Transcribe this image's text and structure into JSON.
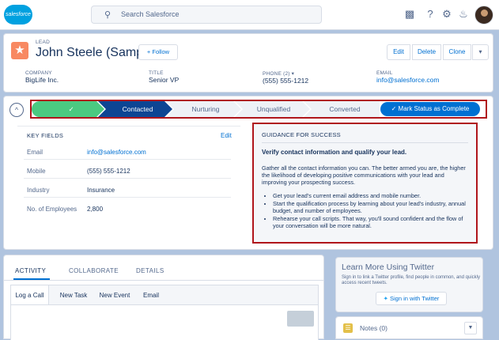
{
  "topbar": {
    "logo_text": "salesforce",
    "search_placeholder": "Search Salesforce",
    "icons": [
      "search-icon",
      "app-launcher-icon",
      "help-icon",
      "setup-gear-icon",
      "notifications-bell-icon"
    ]
  },
  "header": {
    "object_label": "LEAD",
    "record_name": "John Steele (Sample)",
    "follow_label": "+ Follow",
    "actions": {
      "edit": "Edit",
      "delete": "Delete",
      "clone": "Clone",
      "more": "▾"
    },
    "fields": [
      {
        "label": "COMPANY",
        "value": "BigLife Inc."
      },
      {
        "label": "TITLE",
        "value": "Senior VP"
      },
      {
        "label": "PHONE (2) ▾",
        "value": "(555) 555-1212"
      },
      {
        "label": "EMAIL",
        "value": "info@salesforce.com"
      }
    ]
  },
  "path": {
    "completed_icon": "✓",
    "stages": [
      "Contacted",
      "Nurturing",
      "Unqualified",
      "Converted"
    ],
    "current_stage": "Contacted",
    "mark_button": "✓  Mark Status as Complete",
    "colors": {
      "complete": "#4bca81",
      "current": "#0d4593",
      "incomplete": "#eef1f6",
      "highlight": "#b0151b"
    }
  },
  "key_fields": {
    "title": "KEY FIELDS",
    "edit_label": "Edit",
    "rows": [
      {
        "label": "Email",
        "value": "info@salesforce.com"
      },
      {
        "label": "Mobile",
        "value": "(555) 555-1212"
      },
      {
        "label": "Industry",
        "value": "Insurance"
      },
      {
        "label": "No. of Employees",
        "value": "2,800"
      }
    ]
  },
  "guidance": {
    "title": "GUIDANCE FOR SUCCESS",
    "headline": "Verify contact information and qualify your lead.",
    "body": "Gather all the contact information you can. The better armed you are, the higher the likelihood of developing positive communications with your lead and improving your prospecting success.",
    "tips": [
      "Get your lead's current email address and mobile number.",
      "Start the qualification process by learning about your lead's industry, annual budget, and number of employees.",
      "Rehearse your call scripts. That way, you'll sound confident and the flow of your conversation will be more natural."
    ]
  },
  "activity": {
    "tabs": [
      "ACTIVITY",
      "COLLABORATE",
      "DETAILS"
    ],
    "subtabs": [
      "Log a Call",
      "New Task",
      "New Event",
      "Email"
    ]
  },
  "twitter": {
    "title": "Learn More Using Twitter",
    "description": "Sign in to link a Twitter profile, find people in common, and quickly access recent tweets.",
    "button": "Sign in with Twitter"
  },
  "notes": {
    "label": "Notes (0)"
  }
}
